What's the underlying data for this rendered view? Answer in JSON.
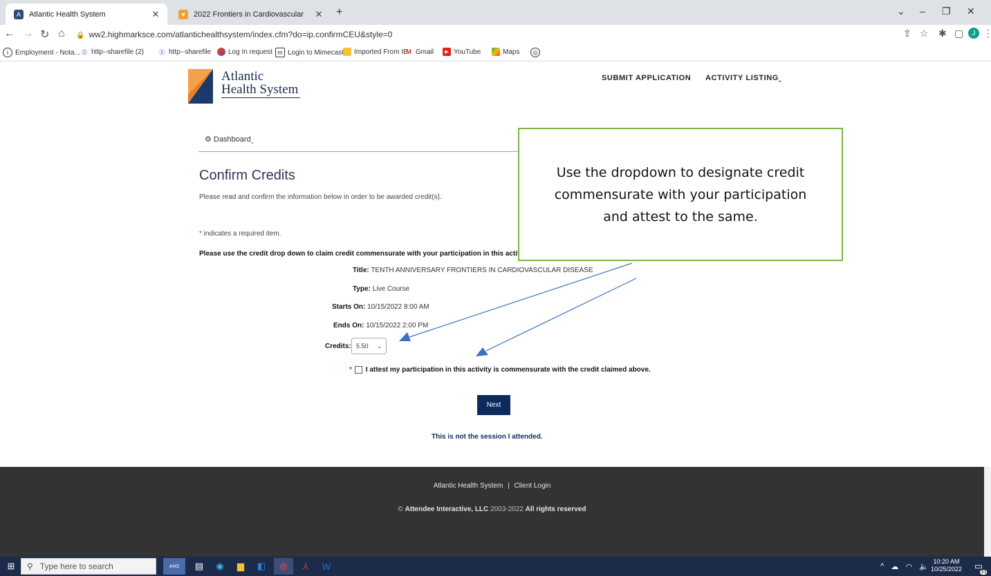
{
  "browser": {
    "tabs": [
      {
        "label": "Atlantic Health System",
        "icon": "atlantic-favicon"
      },
      {
        "label": "2022 Frontiers in Cardiovascular",
        "icon": "heart-favicon"
      }
    ],
    "new_tab": "+",
    "url": "ww2.highmarksce.com/atlantichealthsystem/index.cfm?do=ip.confirmCEU&style=0",
    "profile_initial": "J",
    "bookmarks": [
      {
        "label": "Employment - Nota...",
        "icon": "info-circle"
      },
      {
        "label": "http--sharefile (2)",
        "icon": "sharefile-s"
      },
      {
        "label": "http--sharefile",
        "icon": "sharefile-s"
      },
      {
        "label": "Log In request",
        "icon": "colorful-logo"
      },
      {
        "label": "Login to Mimecast",
        "icon": "mimecast"
      },
      {
        "label": "Imported From IE",
        "icon": "folder"
      },
      {
        "label": "Gmail",
        "icon": "gmail-m"
      },
      {
        "label": "YouTube",
        "icon": "youtube"
      },
      {
        "label": "Maps",
        "icon": "maps-pin"
      }
    ]
  },
  "site": {
    "logo_line1": "Atlantic",
    "logo_line2": "Health System",
    "nav_submit": "SUBMIT APPLICATION",
    "nav_activity": "ACTIVITY LISTING",
    "nav_caret": "ˬ",
    "dashboard": "Dashboard",
    "dashboard_caret": "ˬ"
  },
  "main": {
    "title": "Confirm Credits",
    "description": "Please read and confirm the information below in order to be awarded credit(s).",
    "required_star": "*",
    "required_text": " indicates a required item.",
    "instructions": "Please use the credit drop down to claim credit commensurate with your participation in this activity",
    "fields": {
      "title_label": "Title:",
      "title_value": " TENTH ANNIVERSARY FRONTIERS IN CARDIOVASCULAR DISEASE",
      "type_label": "Type:",
      "type_value": " Live Course",
      "starts_label": "Starts On:",
      "starts_value": " 10/15/2022 8:00 AM",
      "ends_label": "Ends On:",
      "ends_value": " 10/15/2022 2:00 PM",
      "credits_label": "Credits:",
      "credits_value": "5.50"
    },
    "attest_star": "*",
    "attest_text": "I attest my participation in this activity is commensurate with the credit claimed above.",
    "next_label": "Next",
    "not_session": "This is not the session I attended."
  },
  "callout": {
    "text": "Use the dropdown to designate credit commensurate with your participation and attest to the same."
  },
  "footer": {
    "link1": "Atlantic Health System",
    "separator": "|",
    "link2": "Client Login",
    "copy_prefix": "© ",
    "company": "Attendee Interactive, LLC",
    "years": " 2003-2022 ",
    "rights": "All rights reserved"
  },
  "taskbar": {
    "search_placeholder": "Type here to search",
    "time": "10:20 AM",
    "date": "10/25/2022",
    "notification_count": "31"
  },
  "colors": {
    "navy": "#0d2a5c",
    "callout_border": "#7cb342",
    "arrow": "#3b6fc4",
    "footer_bg": "#333333"
  }
}
